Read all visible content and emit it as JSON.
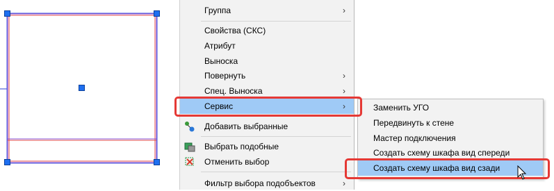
{
  "context_menu": {
    "items": [
      {
        "label": "Группа",
        "submenu": true
      },
      {
        "label": "Свойства (СКС)"
      },
      {
        "label": "Атрибут"
      },
      {
        "label": "Выноска"
      },
      {
        "label": "Повернуть",
        "submenu": true
      },
      {
        "label": "Спец. Выноска",
        "submenu": true
      },
      {
        "label": "Сервис",
        "submenu": true,
        "highlighted": true
      },
      {
        "label": "Добавить выбранные",
        "icon": "add-selected-icon"
      },
      {
        "label": "Выбрать подобные",
        "icon": "select-similar-icon"
      },
      {
        "label": "Отменить выбор",
        "icon": "deselect-icon"
      },
      {
        "label": "Фильтр выбора подобъектов",
        "submenu": true
      }
    ],
    "arrow_glyph": "›"
  },
  "service_submenu": {
    "items": [
      {
        "label": "Заменить УГО"
      },
      {
        "label": "Передвинуть к стене"
      },
      {
        "label": "Мастер подключения"
      },
      {
        "label": "Создать схему шкафа вид спереди"
      },
      {
        "label": "Создать схему шкафа вид сзади",
        "highlighted": true
      }
    ]
  },
  "colors": {
    "highlight": "#9fcaf6",
    "annotation_red": "#e53935",
    "grip_blue": "#1e6ff0",
    "outline_purple": "#8a4fd1"
  }
}
